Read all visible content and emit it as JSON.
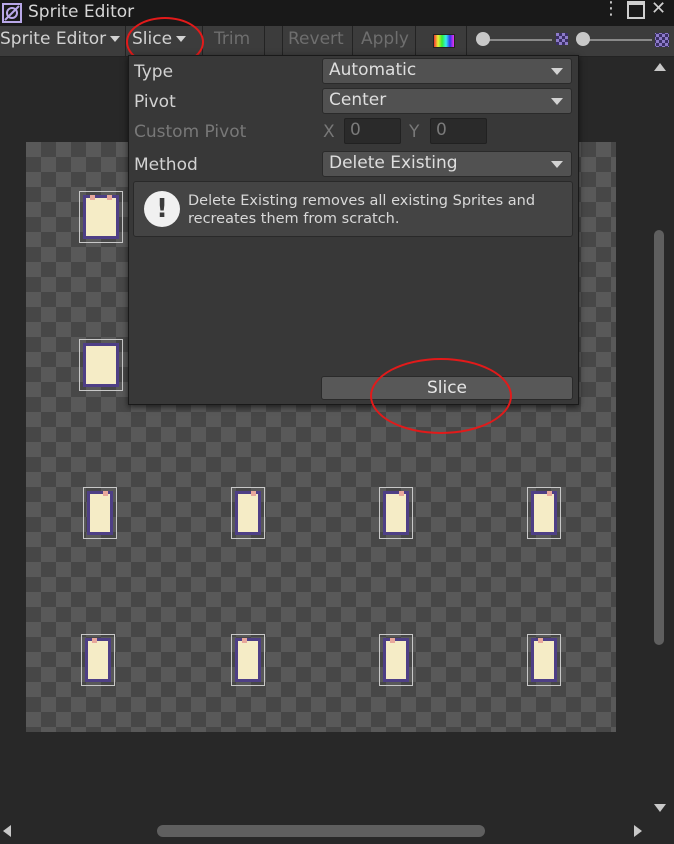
{
  "window": {
    "title": "Sprite Editor",
    "menu_icon": "kebab-menu-icon",
    "maximize_icon": "maximize-icon",
    "close_symbol": "✕"
  },
  "toolbar": {
    "mode_label": "Sprite Editor",
    "slice_label": "Slice",
    "trim_label": "Trim",
    "revert_label": "Revert",
    "apply_label": "Apply",
    "color_toggle_icon": "rgb-channel-icon",
    "zoom_slider_value": 0.0,
    "mip_slider_value": 0.0
  },
  "slice_popup": {
    "type_label": "Type",
    "type_value": "Automatic",
    "pivot_label": "Pivot",
    "pivot_value": "Center",
    "custom_pivot_label": "Custom Pivot",
    "x_label": "X",
    "x_value": "0",
    "y_label": "Y",
    "y_value": "0",
    "method_label": "Method",
    "method_value": "Delete Existing",
    "help_text": "Delete Existing removes all existing Sprites and recreates them from scratch.",
    "info_symbol": "!",
    "slice_button_label": "Slice"
  },
  "sprites": {
    "count": 10
  },
  "colors": {
    "highlight": "#e21a1a",
    "sprite_fill": "#f5ecc6",
    "sprite_outline": "#4e3f86"
  }
}
